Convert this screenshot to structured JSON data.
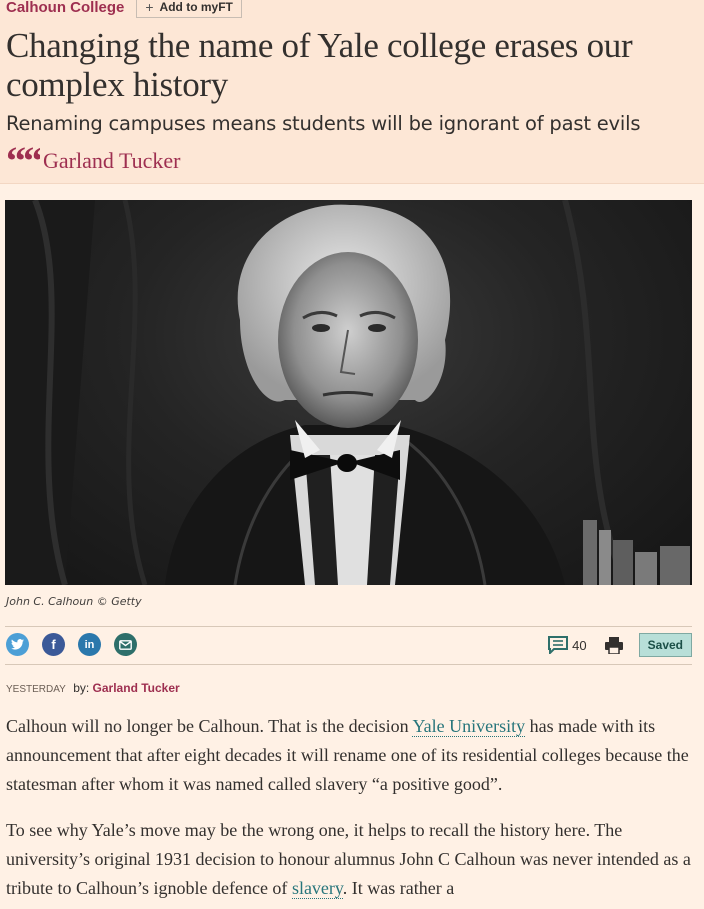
{
  "header": {
    "topic": "Calhoun College",
    "add_to_myft": "Add to myFT",
    "headline": "Changing the name of Yale college erases our complex history",
    "standfirst": "Renaming campuses means students will be ignorant of past evils",
    "quote_mark": "““",
    "author": "Garland Tucker"
  },
  "image": {
    "caption": "John C. Calhoun © Getty"
  },
  "share": {
    "icons": [
      "twitter-icon",
      "facebook-icon",
      "linkedin-icon",
      "email-icon"
    ]
  },
  "tools": {
    "comment_count": "40",
    "saved_label": "Saved"
  },
  "meta": {
    "date": "YESTERDAY",
    "by": "by:",
    "author": "Garland Tucker"
  },
  "body": {
    "p1_a": "Calhoun will no longer be Calhoun. That is the decision ",
    "p1_link": "Yale University",
    "p1_b": " has made with its announcement that after eight decades it will rename one of its residential colleges because the statesman after whom it was named called slavery “a positive good”.",
    "p2_a": "To see why Yale’s move may be the wrong one, it helps to recall the history here. The university’s original 1931 decision to honour alumnus John C Calhoun was never intended as a tribute to Calhoun’s ignoble defence of ",
    "p2_link": "slavery",
    "p2_b": ". It was rather a"
  },
  "colors": {
    "background": "#fff1e5",
    "header_band": "#fde7d6",
    "accent_claret": "#9e2f50",
    "link_teal": "#27757b",
    "saved_bg": "#b8dfd8"
  }
}
